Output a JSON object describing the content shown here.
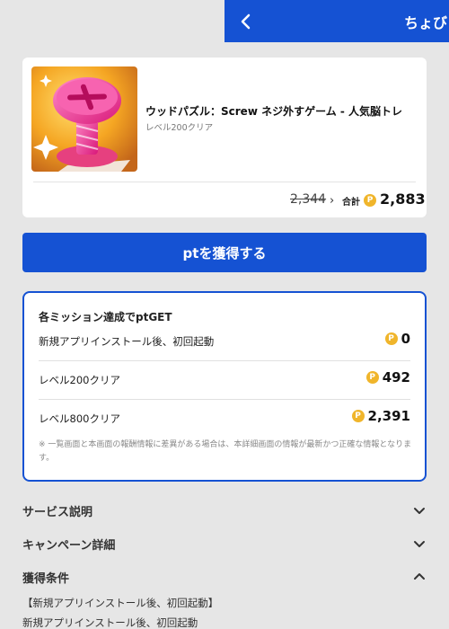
{
  "header": {
    "title": "ちょびリッチ"
  },
  "app": {
    "name": "ウッドパズル：Screw ネジ外すゲーム - 人気脳トレ",
    "subtitle": "レベル200クリア",
    "old_points": "2,344",
    "total_label": "合計",
    "total_points": "2,883"
  },
  "cta": {
    "label": "ptを獲得する"
  },
  "missions": {
    "title": "各ミッション達成でptGET",
    "items": [
      {
        "label": "新規アプリインストール後、初回起動",
        "points": "0"
      },
      {
        "label": "レベル200クリア",
        "points": "492"
      },
      {
        "label": "レベル800クリア",
        "points": "2,391"
      }
    ],
    "note": "※ 一覧画面と本画面の報酬情報に差異がある場合は、本詳細画面の情報が最新かつ正確な情報となります。"
  },
  "sections": [
    {
      "label": "サービス説明",
      "state": "collapsed"
    },
    {
      "label": "キャンペーン詳細",
      "state": "collapsed"
    },
    {
      "label": "獲得条件",
      "state": "expanded"
    }
  ],
  "conditions": {
    "heading": "【新規アプリインストール後、初回起動】",
    "line1": "新規アプリインストール後、初回起動"
  },
  "icons": {
    "back": "chevron-left-icon",
    "coin": "point-coin-icon",
    "expand": "chevron-down-icon",
    "collapse": "chevron-up-icon"
  },
  "colors": {
    "brand": "#1552d3",
    "coin": "#f0b52b",
    "background": "#e6e6e6"
  }
}
